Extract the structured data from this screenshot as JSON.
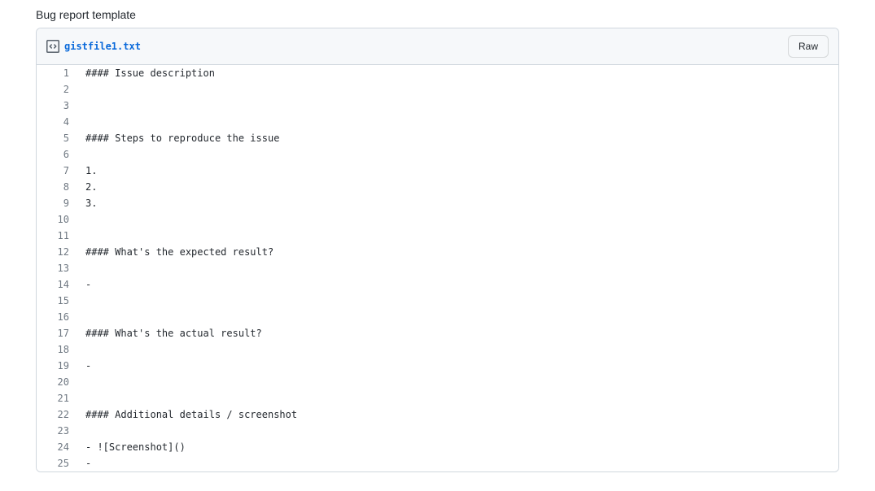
{
  "title": "Bug report template",
  "file": {
    "name": "gistfile1.txt",
    "raw_button": "Raw",
    "lines": [
      "#### Issue description",
      "",
      "",
      "",
      "#### Steps to reproduce the issue",
      "",
      "1.",
      "2.",
      "3.",
      "",
      "",
      "#### What's the expected result?",
      "",
      "-",
      "",
      "",
      "#### What's the actual result?",
      "",
      "-",
      "",
      "",
      "#### Additional details / screenshot",
      "",
      "- ![Screenshot]()",
      "-"
    ]
  }
}
